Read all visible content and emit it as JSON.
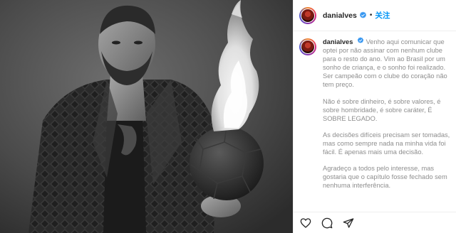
{
  "post": {
    "username": "danialves",
    "follow_label": "关注",
    "separator": "•",
    "caption_paragraphs": [
      "Venho aqui comunicar que optei por não assinar com nenhum clube para o resto do ano. Vim ao Brasil por um sonho de criança, e o sonho foi realizado. Ser campeão com o clube do coração não tem preço.",
      "Não é sobre dinheiro, é sobre valores, é sobre hombridade, é sobre caráter, É SOBRE LEGADO.",
      "As decisões difíceis precisam ser tomadas, mas como sempre nada na minha vida foi fácil. É apenas mais uma decisão.",
      "Agradeço a todos pelo interesse, mas gostaria que o capítulo fosse fechado sem nenhuma interferência."
    ],
    "icons": [
      "verified-badge-icon",
      "heart-icon",
      "comment-icon",
      "share-icon"
    ],
    "colors": {
      "link": "#0095f6",
      "verified": "#3897f0",
      "text": "#262626",
      "muted": "#8e8e8e"
    }
  }
}
